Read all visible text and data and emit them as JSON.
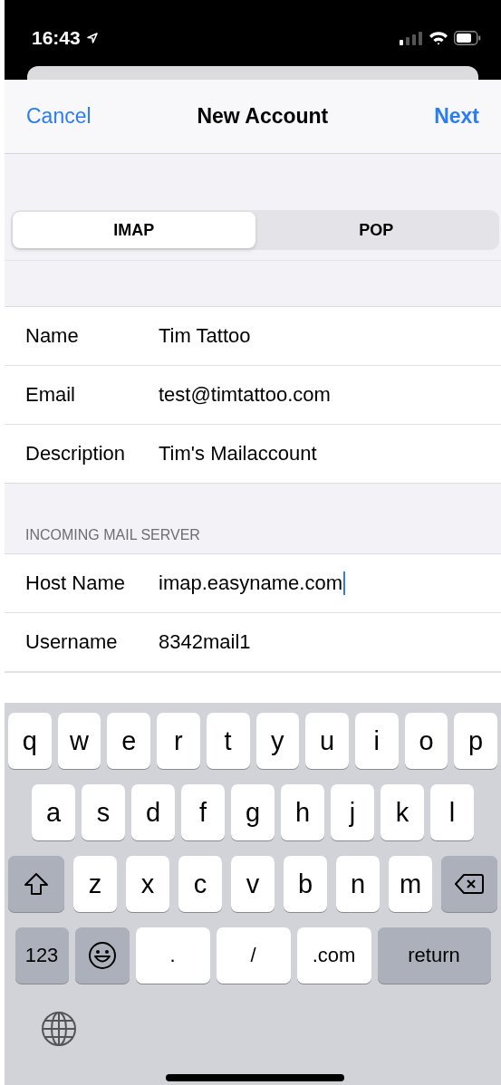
{
  "status_bar": {
    "time": "16:43"
  },
  "nav": {
    "cancel": "Cancel",
    "title": "New Account",
    "next": "Next"
  },
  "segments": [
    {
      "label": "IMAP",
      "selected": true
    },
    {
      "label": "POP",
      "selected": false
    }
  ],
  "sections": [
    {
      "rows": [
        {
          "label": "Name",
          "value": "Tim Tattoo",
          "focused": false
        },
        {
          "label": "Email",
          "value": "test@timtattoo.com",
          "focused": false
        },
        {
          "label": "Description",
          "value": "Tim's Mailaccount",
          "focused": false
        }
      ]
    },
    {
      "header": "INCOMING MAIL SERVER",
      "rows": [
        {
          "label": "Host Name",
          "value": "imap.easyname.com",
          "focused": true
        },
        {
          "label": "Username",
          "value": "8342mail1",
          "focused": false
        }
      ]
    }
  ],
  "keyboard": {
    "rows": [
      {
        "keys": [
          {
            "kind": "char",
            "label": "q"
          },
          {
            "kind": "char",
            "label": "w"
          },
          {
            "kind": "char",
            "label": "e"
          },
          {
            "kind": "char",
            "label": "r"
          },
          {
            "kind": "char",
            "label": "t"
          },
          {
            "kind": "char",
            "label": "y"
          },
          {
            "kind": "char",
            "label": "u"
          },
          {
            "kind": "char",
            "label": "i"
          },
          {
            "kind": "char",
            "label": "o"
          },
          {
            "kind": "char",
            "label": "p"
          }
        ]
      },
      {
        "keys": [
          {
            "kind": "char",
            "label": "a"
          },
          {
            "kind": "char",
            "label": "s"
          },
          {
            "kind": "char",
            "label": "d"
          },
          {
            "kind": "char",
            "label": "f"
          },
          {
            "kind": "char",
            "label": "g"
          },
          {
            "kind": "char",
            "label": "h"
          },
          {
            "kind": "char",
            "label": "j"
          },
          {
            "kind": "char",
            "label": "k"
          },
          {
            "kind": "char",
            "label": "l"
          }
        ]
      },
      {
        "keys": [
          {
            "kind": "shift"
          },
          {
            "kind": "char",
            "label": "z"
          },
          {
            "kind": "char",
            "label": "x"
          },
          {
            "kind": "char",
            "label": "c"
          },
          {
            "kind": "char",
            "label": "v"
          },
          {
            "kind": "char",
            "label": "b"
          },
          {
            "kind": "char",
            "label": "n"
          },
          {
            "kind": "char",
            "label": "m"
          },
          {
            "kind": "delete"
          }
        ]
      },
      {
        "keys": [
          {
            "kind": "numbers",
            "label": "123"
          },
          {
            "kind": "emoji"
          },
          {
            "kind": "wide",
            "label": "."
          },
          {
            "kind": "wide",
            "label": "/"
          },
          {
            "kind": "wide",
            "label": ".com"
          },
          {
            "kind": "return",
            "label": "return"
          }
        ]
      }
    ]
  }
}
